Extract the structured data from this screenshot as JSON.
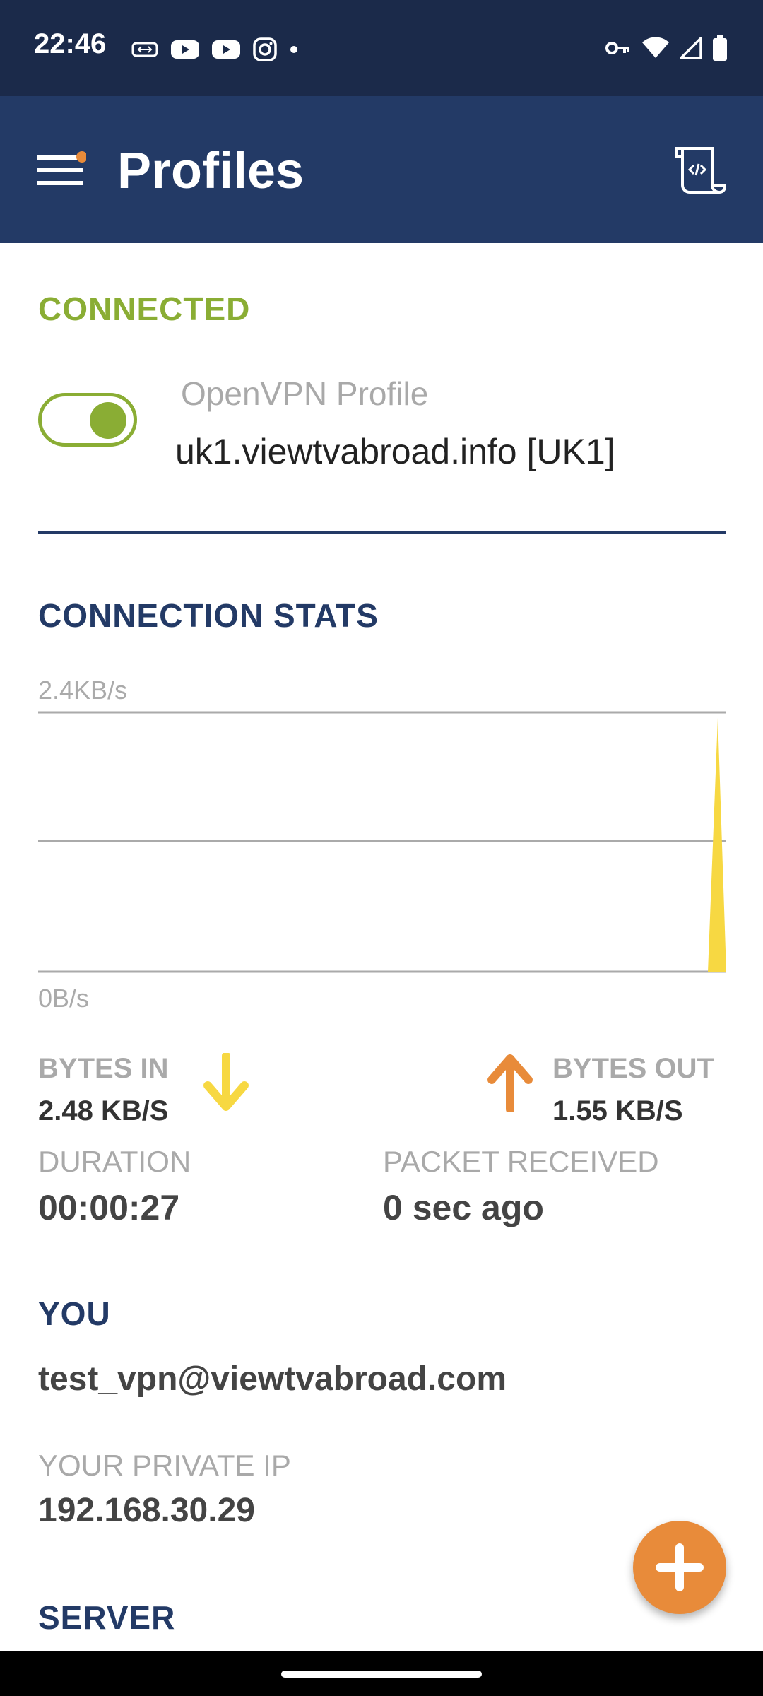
{
  "status_bar": {
    "time": "22:46",
    "left_icons": [
      "vpn-badge-icon",
      "youtube-icon",
      "youtube-icon",
      "instagram-icon",
      "dot-icon"
    ],
    "right_icons": [
      "key-icon",
      "wifi-icon",
      "signal-icon",
      "battery-icon"
    ]
  },
  "app_bar": {
    "title": "Profiles",
    "menu_icon": "menu-icon",
    "log_icon": "log-icon"
  },
  "connection": {
    "status": "CONNECTED",
    "profile_type": "OpenVPN Profile",
    "profile_name": "uk1.viewtvabroad.info [UK1]",
    "toggle_on": true
  },
  "stats": {
    "title": "CONNECTION STATS",
    "chart_max_label": "2.4KB/s",
    "chart_min_label": "0B/s",
    "bytes_in_label": "BYTES IN",
    "bytes_in_value": "2.48 KB/S",
    "bytes_out_label": "BYTES OUT",
    "bytes_out_value": "1.55 KB/S",
    "duration_label": "DURATION",
    "duration_value": "00:00:27",
    "packet_label": "PACKET RECEIVED",
    "packet_value": "0 sec ago"
  },
  "you": {
    "title": "YOU",
    "email": "test_vpn@viewtvabroad.com",
    "ip_label": "YOUR PRIVATE IP",
    "ip_value": "192.168.30.29"
  },
  "server": {
    "title": "SERVER"
  },
  "colors": {
    "app_bar": "#233a66",
    "status_bar": "#1b2a4a",
    "connected": "#8aad34",
    "accent_orange": "#e88b3a",
    "chart_yellow": "#f7d842"
  }
}
